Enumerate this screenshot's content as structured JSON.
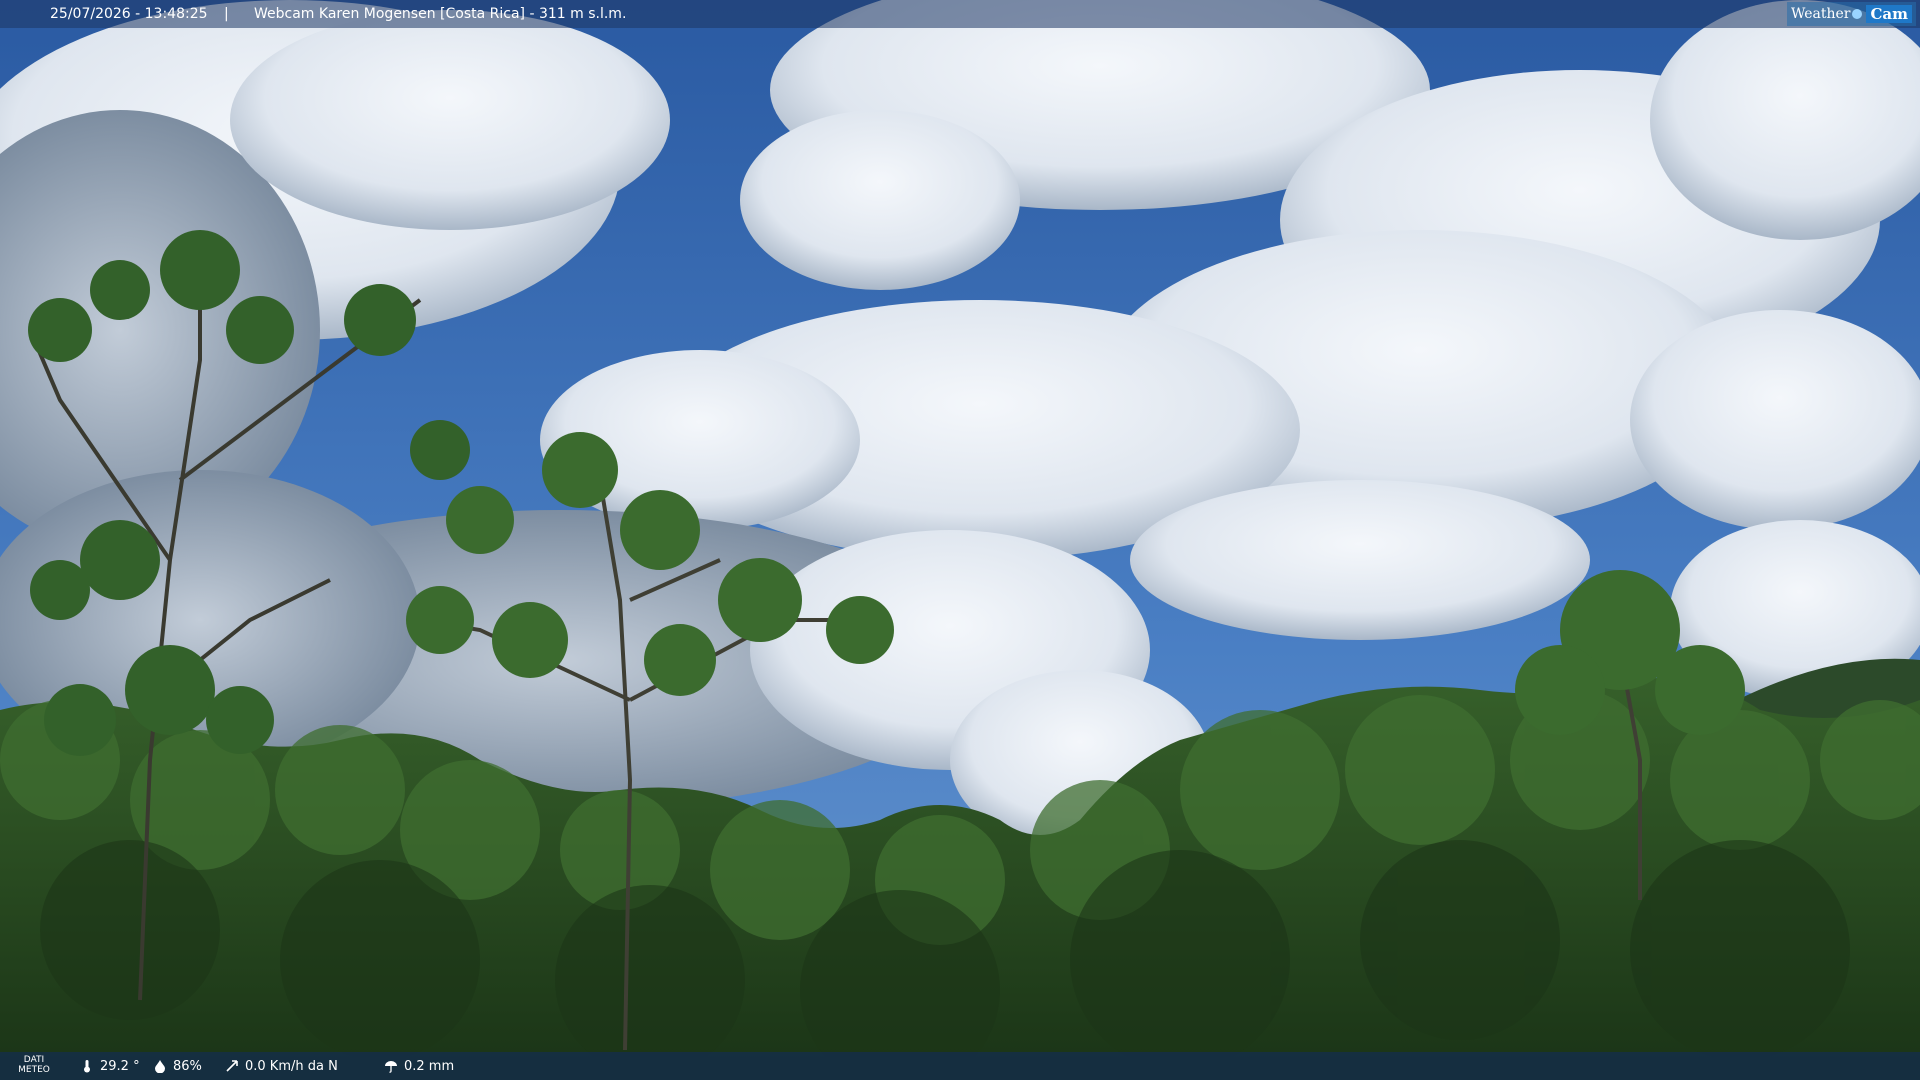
{
  "header": {
    "datetime": "25/07/2026 - 13:48:25",
    "separator": "|",
    "title": "Webcam Karen Mogensen [Costa Rica]  - 311 m s.l.m."
  },
  "brand": {
    "left": "Weather",
    "right": "Cam"
  },
  "weather": {
    "label_line1": "DATI",
    "label_line2": "METEO",
    "temperature": "29.2 °",
    "humidity": "86%",
    "wind": "0.0 Km/h da N",
    "rain": "0.2 mm"
  },
  "colors": {
    "sky_top": "#2c5fa8",
    "sky_mid": "#4c7fc2",
    "cloud": "#e8eef5",
    "forest_dark": "#1f3a1a",
    "forest_mid": "#2f5a26",
    "forest_light": "#4f7f38",
    "bar": "#1e3764"
  },
  "icons": [
    "thermometer-icon",
    "humidity-icon",
    "wind-icon",
    "rain-icon",
    "camera-logo-icon"
  ]
}
